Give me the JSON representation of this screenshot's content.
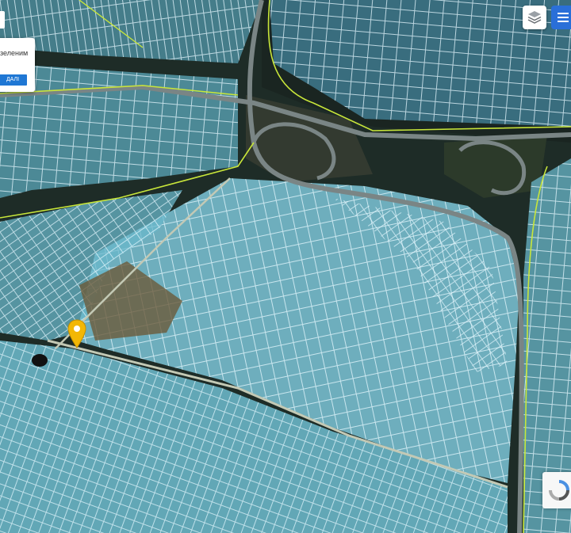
{
  "tooltip": {
    "text": "зеленим",
    "button_label": "ДАЛІ"
  },
  "controls": {
    "layers_icon": "layers-icon",
    "menu_icon": "hamburger-menu-icon",
    "marker_icon": "map-pin-icon",
    "badge_icon": "recaptcha-icon"
  },
  "colors": {
    "parcel_fill": "#76c4d6",
    "parcel_stroke": "#e6f8ff",
    "boundary_line": "#c8e63a",
    "road": "#707a7a",
    "marker": "#f2b705",
    "menu_button": "#2a6fd8"
  }
}
